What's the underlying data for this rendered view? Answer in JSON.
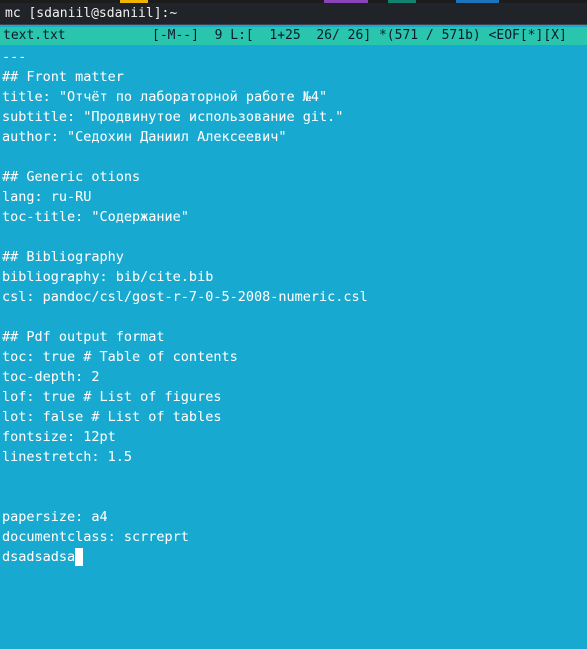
{
  "terminal": {
    "title": "mc [sdaniil@sdaniil]:~"
  },
  "editor": {
    "status": {
      "filename": "text.txt",
      "info": "[-M--]  9 L:[  1+25  26/ 26] *(571 / 571b) <EOF[*][X]"
    },
    "lines": [
      "---",
      "## Front matter",
      "title: \"Отчёт по лабораторной работе №4\"",
      "subtitle: \"Продвинутое использование git.\"",
      "author: \"Седохин Даниил Алексеевич\"",
      "",
      "## Generic otions",
      "lang: ru-RU",
      "toc-title: \"Содержание\"",
      "",
      "## Bibliography",
      "bibliography: bib/cite.bib",
      "csl: pandoc/csl/gost-r-7-0-5-2008-numeric.csl",
      "",
      "## Pdf output format",
      "toc: true # Table of contents",
      "toc-depth: 2",
      "lof: true # List of figures",
      "lot: false # List of tables",
      "fontsize: 12pt",
      "linestretch: 1.5",
      "",
      "",
      "papersize: a4",
      "documentclass: scrreprt",
      "dsadsadsa"
    ]
  },
  "colors": {
    "editor_bg": "#17a9cf",
    "status_bg": "#29c6ad",
    "status_fg": "#0b1b2b",
    "titlebar_bg": "#202328",
    "text": "#ffffff",
    "cursor": "#ffffff"
  }
}
